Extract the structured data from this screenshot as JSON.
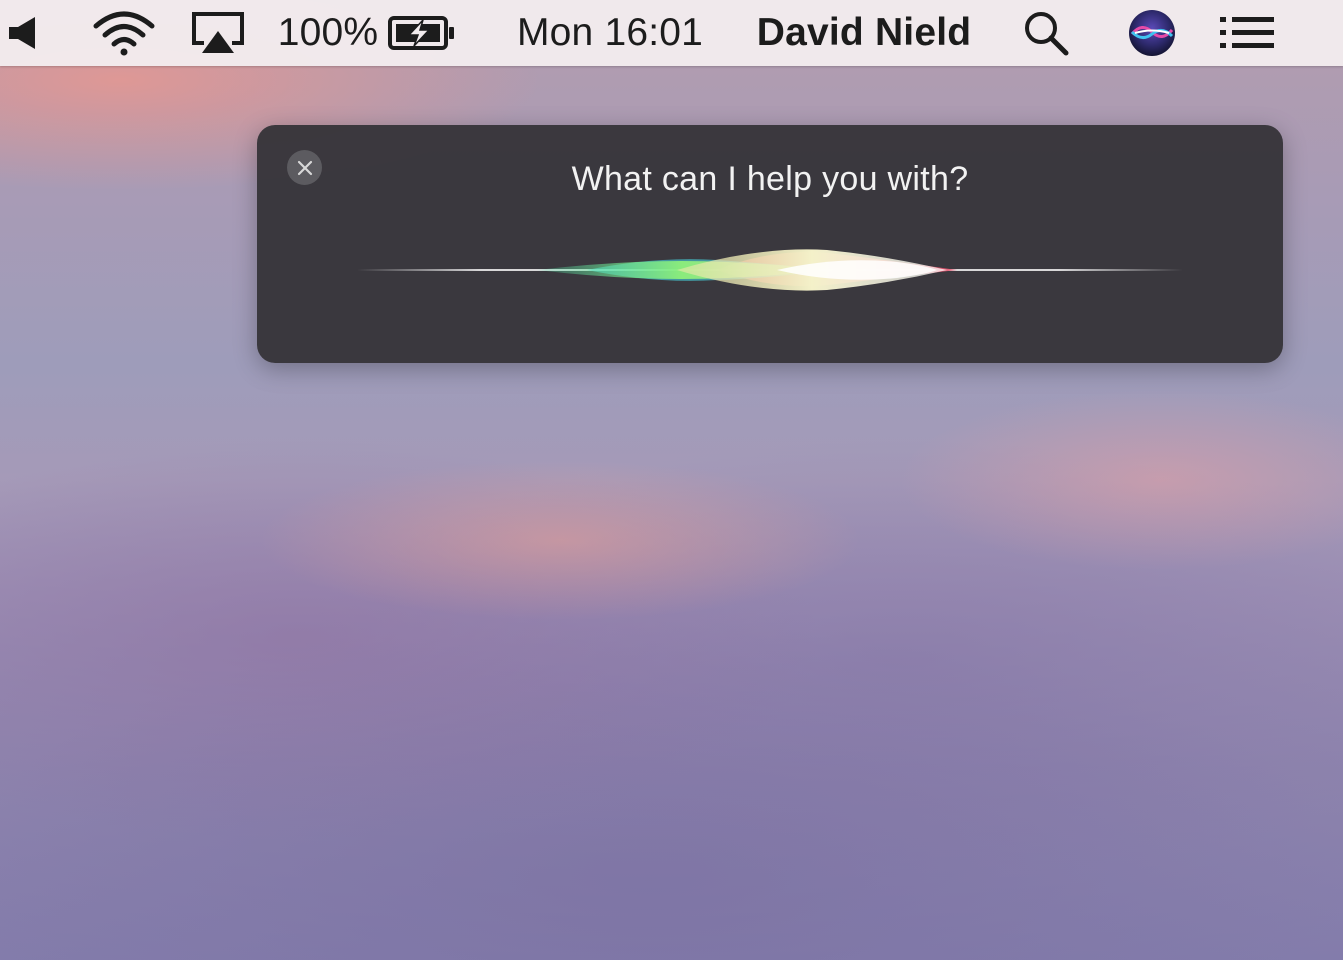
{
  "menubar": {
    "volume_icon": "speaker-icon",
    "wifi_icon": "wifi-icon",
    "airplay_icon": "airplay-icon",
    "battery_percent": "100%",
    "battery_icon": "battery-charging-icon",
    "clock": "Mon 16:01",
    "user_name": "David Nield",
    "spotlight_icon": "magnifying-glass-icon",
    "siri_icon": "siri-icon",
    "notification_center_icon": "list-icon"
  },
  "siri": {
    "close_icon": "close-icon",
    "prompt": "What can I help you with?",
    "waveform_icon": "siri-waveform"
  },
  "colors": {
    "menubar_bg": "#f2ecee",
    "panel_bg": "#37353a",
    "prompt_text": "#f2f2f2"
  }
}
